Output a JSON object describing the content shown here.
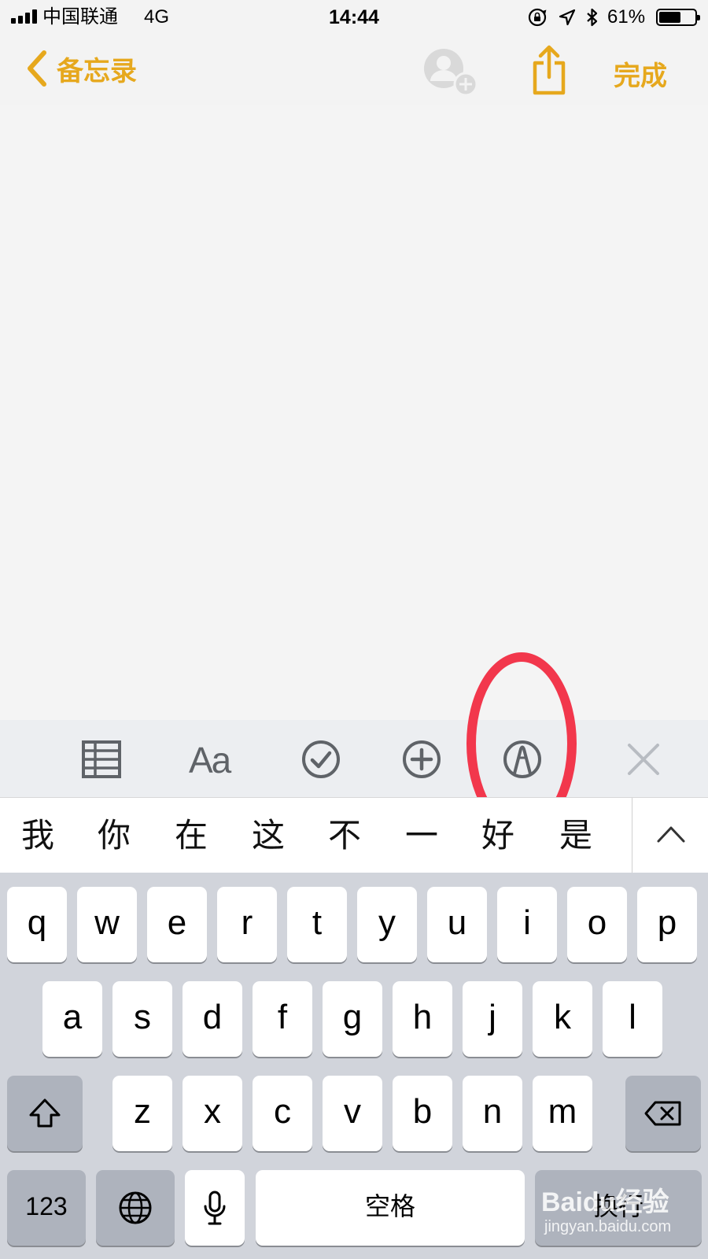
{
  "status_bar": {
    "carrier": "中国联通",
    "network": "4G",
    "time": "14:44",
    "battery_percent": "61%",
    "battery_level": 0.61,
    "icons": [
      "orientation-lock-icon",
      "location-icon",
      "bluetooth-icon",
      "battery-icon"
    ]
  },
  "nav": {
    "back_label": "备忘录",
    "done_label": "完成",
    "accent_color": "#e6a81d"
  },
  "toolbar": {
    "items": [
      "table-icon",
      "text-format-icon",
      "checklist-icon",
      "add-icon",
      "markup-icon",
      "close-icon"
    ],
    "format_label": "Aa",
    "highlight_color": "#f2374c"
  },
  "candidates": {
    "words": [
      "我",
      "你",
      "在",
      "这",
      "不",
      "一",
      "好",
      "是"
    ]
  },
  "keyboard": {
    "row1": [
      "q",
      "w",
      "e",
      "r",
      "t",
      "y",
      "u",
      "i",
      "o",
      "p"
    ],
    "row2": [
      "a",
      "s",
      "d",
      "f",
      "g",
      "h",
      "j",
      "k",
      "l"
    ],
    "row3": [
      "z",
      "x",
      "c",
      "v",
      "b",
      "n",
      "m"
    ],
    "numbers_label": "123",
    "space_label": "空格",
    "return_label": "换行"
  },
  "watermark": {
    "logo": "Baidu经验",
    "url": "jingyan.baidu.com"
  }
}
